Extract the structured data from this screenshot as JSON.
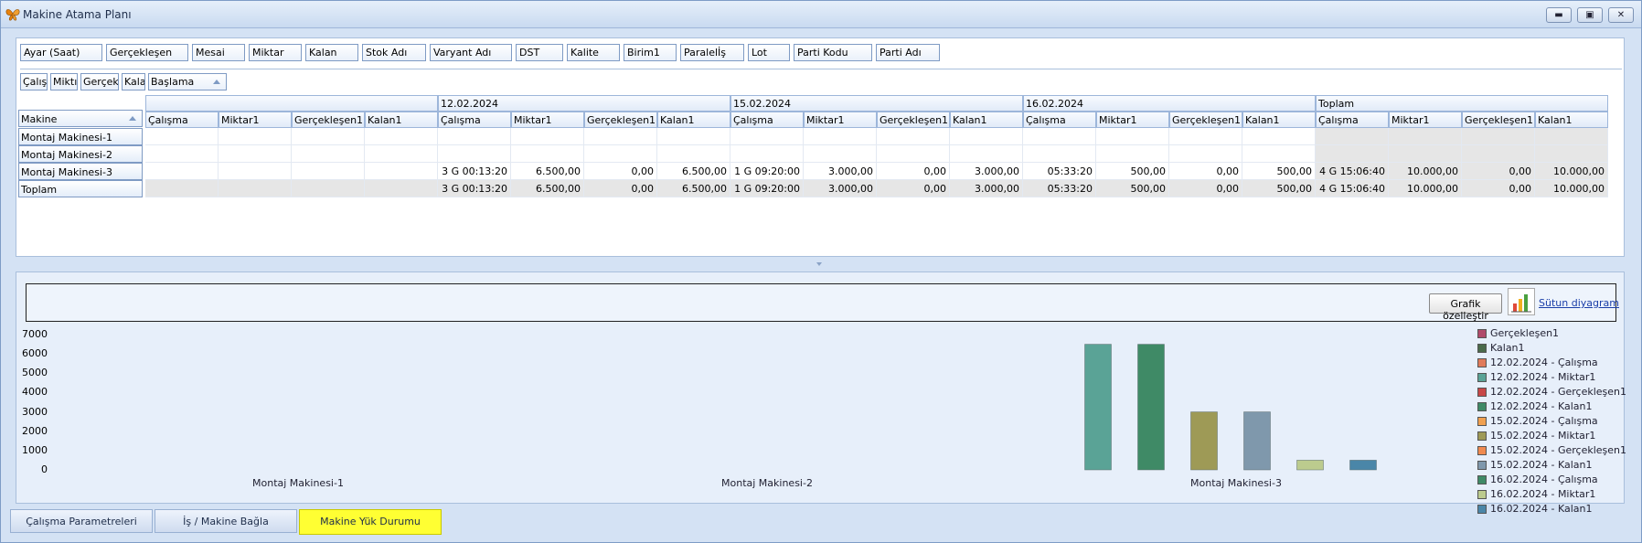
{
  "window": {
    "title": "Makine Atama Planı"
  },
  "field_chips": [
    "Ayar (Saat)",
    "Gerçekleşen",
    "Mesai",
    "Miktar",
    "Kalan",
    "Stok Adı",
    "Varyant Adı",
    "DST",
    "Kalite",
    "Birim1",
    "Paralelİş",
    "Lot",
    "Parti Kodu",
    "Parti Adı"
  ],
  "column_chips": [
    "Çalışı",
    "Miktı",
    "Gerçekl",
    "Kala",
    "Başlama"
  ],
  "row_header_field": "Makine",
  "date_groups": [
    "12.02.2024",
    "15.02.2024",
    "16.02.2024",
    "Toplam"
  ],
  "measures": [
    "Çalışma",
    "Miktar1",
    "Gerçekleşen1",
    "Kalan1"
  ],
  "rows": [
    {
      "label": "Montaj Makinesi-1",
      "cells": [
        "",
        "",
        "",
        "",
        "",
        "",
        "",
        "",
        "",
        "",
        "",
        "",
        "",
        "",
        "",
        "",
        "",
        "",
        "",
        ""
      ]
    },
    {
      "label": "Montaj Makinesi-2",
      "cells": [
        "",
        "",
        "",
        "",
        "",
        "",
        "",
        "",
        "",
        "",
        "",
        "",
        "",
        "",
        "",
        "",
        "",
        "",
        "",
        ""
      ]
    },
    {
      "label": "Montaj Makinesi-3",
      "cells": [
        "",
        "",
        "",
        "",
        "3 G 00:13:20",
        "6.500,00",
        "0,00",
        "6.500,00",
        "1 G 09:20:00",
        "3.000,00",
        "0,00",
        "3.000,00",
        "05:33:20",
        "500,00",
        "0,00",
        "500,00",
        "4 G 15:06:40",
        "10.000,00",
        "0,00",
        "10.000,00"
      ]
    },
    {
      "label": "Toplam",
      "cells": [
        "",
        "",
        "",
        "",
        "3 G 00:13:20",
        "6.500,00",
        "0,00",
        "6.500,00",
        "1 G 09:20:00",
        "3.000,00",
        "0,00",
        "3.000,00",
        "05:33:20",
        "500,00",
        "0,00",
        "500,00",
        "4 G 15:06:40",
        "10.000,00",
        "0,00",
        "10.000,00"
      ]
    }
  ],
  "chart_toolbar": {
    "customize_label": "Grafik özelleştir",
    "chart_type_label": "Sütun diyagram"
  },
  "chart_data": {
    "type": "bar",
    "categories": [
      "Montaj Makinesi-1",
      "Montaj Makinesi-2",
      "Montaj Makinesi-3"
    ],
    "ylim": [
      0,
      7000
    ],
    "yticks": [
      0,
      1000,
      2000,
      3000,
      4000,
      5000,
      6000,
      7000
    ],
    "grid": false,
    "legend_position": "right",
    "series": [
      {
        "name": "Gerçekleşen1",
        "color": "#b04a6a",
        "values": [
          0,
          0,
          0
        ]
      },
      {
        "name": "Kalan1",
        "color": "#4a6a4a",
        "values": [
          0,
          0,
          0
        ]
      },
      {
        "name": "12.02.2024 - Çalışma",
        "color": "#e07a5a",
        "values": [
          0,
          0,
          0
        ]
      },
      {
        "name": "12.02.2024 - Miktar1",
        "color": "#5aa396",
        "values": [
          0,
          0,
          6500
        ]
      },
      {
        "name": "12.02.2024 - Gerçekleşen1",
        "color": "#c84848",
        "values": [
          0,
          0,
          0
        ]
      },
      {
        "name": "12.02.2024 - Kalan1",
        "color": "#3f8a66",
        "values": [
          0,
          0,
          6500
        ]
      },
      {
        "name": "15.02.2024 - Çalışma",
        "color": "#f0a050",
        "values": [
          0,
          0,
          0
        ]
      },
      {
        "name": "15.02.2024 - Miktar1",
        "color": "#9e9a56",
        "values": [
          0,
          0,
          3000
        ]
      },
      {
        "name": "15.02.2024 - Gerçekleşen1",
        "color": "#f08a50",
        "values": [
          0,
          0,
          0
        ]
      },
      {
        "name": "15.02.2024 - Kalan1",
        "color": "#7f98ac",
        "values": [
          0,
          0,
          3000
        ]
      },
      {
        "name": "16.02.2024 - Çalışma",
        "color": "#3f8a66",
        "values": [
          0,
          0,
          0
        ]
      },
      {
        "name": "16.02.2024 - Miktar1",
        "color": "#bccb8e",
        "values": [
          0,
          0,
          500
        ]
      },
      {
        "name": "16.02.2024 - Kalan1",
        "color": "#4a86a8",
        "values": [
          0,
          0,
          500
        ]
      }
    ]
  },
  "tabs": [
    {
      "label": "Çalışma Parametreleri",
      "active": false
    },
    {
      "label": "İş / Makine Bağla",
      "active": false
    },
    {
      "label": "Makine Yük Durumu",
      "active": true
    }
  ]
}
